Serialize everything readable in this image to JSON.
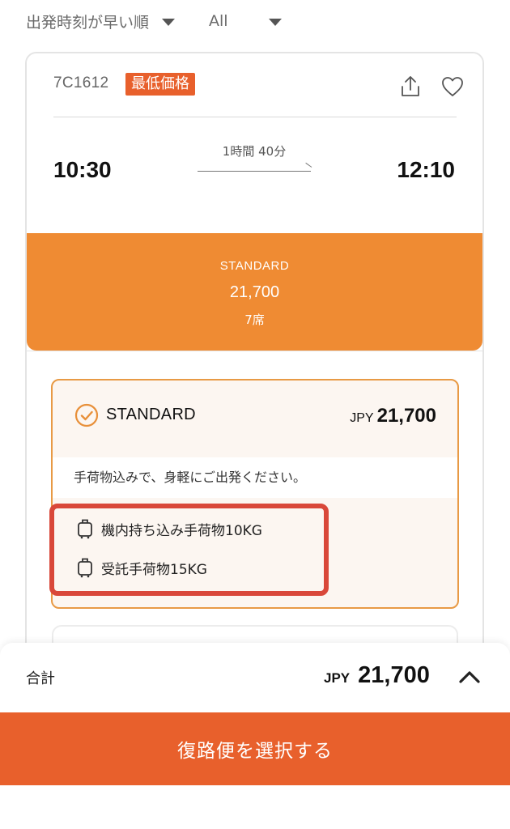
{
  "filters": {
    "sort_label": "出発時刻が早い順",
    "class_label": "All"
  },
  "flight": {
    "number": "7C1612",
    "badge": "最低価格",
    "departure_time": "10:30",
    "arrival_time": "12:10",
    "duration": "1時間 40分"
  },
  "fare_tab": {
    "name": "STANDARD",
    "price": "21,700",
    "seats": "7席"
  },
  "fare_detail": {
    "name": "STANDARD",
    "currency": "JPY",
    "price": "21,700",
    "description": "手荷物込みで、身軽にご出発ください。",
    "baggage": [
      {
        "label": "機内持ち込み手荷物10KG",
        "icon": "suitcase-icon"
      },
      {
        "label": "受託手荷物15KG",
        "icon": "suitcase-icon"
      }
    ]
  },
  "summary": {
    "label": "合計",
    "currency": "JPY",
    "price": "21,700"
  },
  "cta": {
    "label": "復路便を選択する"
  },
  "colors": {
    "brand_orange": "#e8602c",
    "fare_tab_orange": "#ef8b33",
    "highlight_red": "#d9483a"
  }
}
